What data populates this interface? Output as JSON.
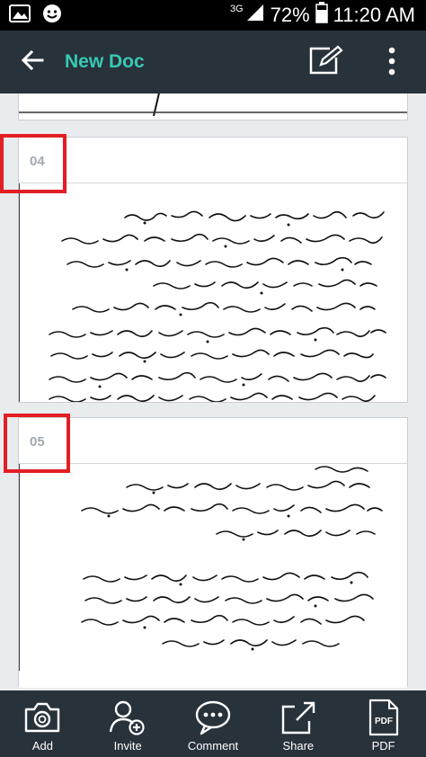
{
  "status_bar": {
    "network": "3G",
    "battery": "72%",
    "time": "11:20 AM",
    "icons": [
      "gallery-icon",
      "emoji-icon",
      "signal-icon",
      "battery-icon"
    ]
  },
  "app_bar": {
    "title": "New Doc",
    "back_icon": "arrow-back-icon",
    "edit_icon": "edit-icon",
    "more_icon": "more-vert-icon"
  },
  "pages": [
    {
      "number": ""
    },
    {
      "number": "04"
    },
    {
      "number": "05"
    }
  ],
  "bottom_bar": {
    "items": [
      {
        "label": "Add",
        "icon": "camera-icon"
      },
      {
        "label": "Invite",
        "icon": "add-person-icon"
      },
      {
        "label": "Comment",
        "icon": "comment-icon"
      },
      {
        "label": "Share",
        "icon": "share-icon"
      },
      {
        "label": "PDF",
        "icon": "pdf-icon"
      }
    ]
  },
  "colors": {
    "app_bar": "#28323b",
    "accent": "#37c9b2",
    "highlight": "#e31e24",
    "background": "#e9ecef"
  }
}
